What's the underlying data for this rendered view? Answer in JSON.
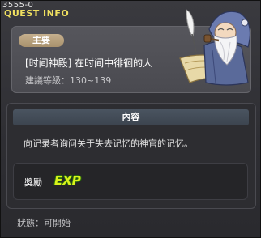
{
  "window": {
    "quest_id": "3555-0",
    "title": "QUEST INFO"
  },
  "quest": {
    "category_badge": "主要",
    "name": "[时间神殿] 在时间中徘徊的人",
    "level_range": "建議等級：130~139",
    "npc_icon": "elder-sage-npc-icon"
  },
  "content": {
    "header": "內容",
    "description": "向记录者询问关于失去记忆的神官的记忆。",
    "reward_label": "獎勵",
    "reward_icon_text": "EXP",
    "reward_icon_color": "#d8f21a"
  },
  "status": {
    "text": "狀態：可開始"
  }
}
